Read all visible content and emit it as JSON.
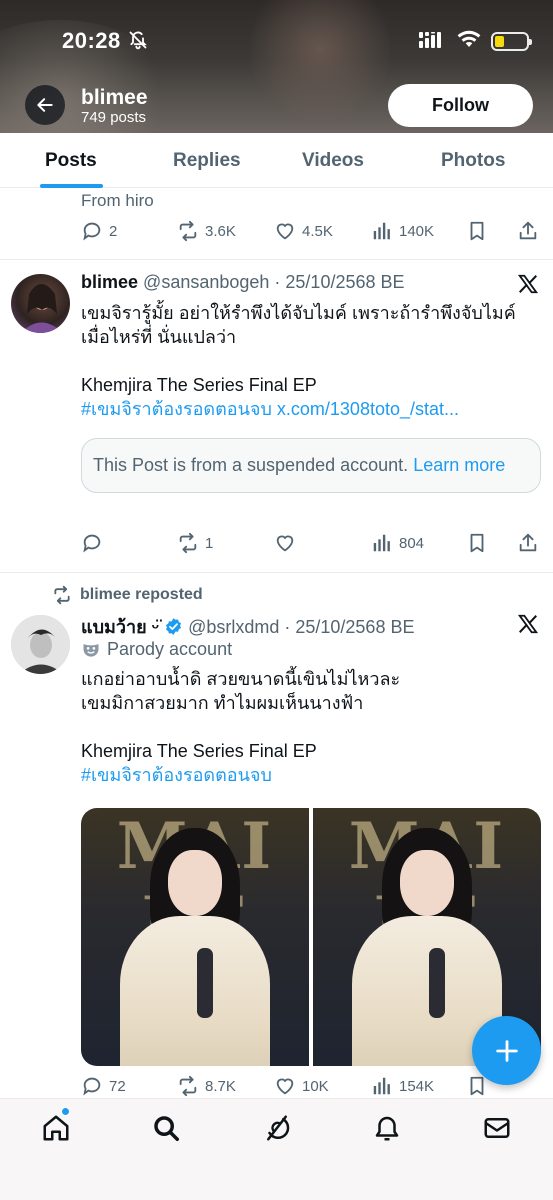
{
  "status_bar": {
    "time": "20:28"
  },
  "profile": {
    "name": "blimee",
    "posts_count": "749 posts",
    "follow_label": "Follow"
  },
  "tabs": [
    {
      "label": "Posts",
      "active": true
    },
    {
      "label": "Replies",
      "active": false
    },
    {
      "label": "Videos",
      "active": false
    },
    {
      "label": "Photos",
      "active": false
    }
  ],
  "feed": {
    "partial_post": {
      "text": "From hiro",
      "replies": "2",
      "reposts": "3.6K",
      "likes": "4.5K",
      "views": "140K"
    },
    "post1": {
      "name": "blimee",
      "meta": "@sansanbogeh · 25/10/2568 BE",
      "line1": "เขมจิรารู้มั้ย อย่าให้รำพึงได้จับไมค์ เพราะถ้ารำพึงจับไมค์",
      "line2": "เมื่อไหร่ที่ นั่นแปลว่า",
      "line3": "Khemjira The Series Final EP",
      "hashtag": "#เขมจิราต้องรอดตอนจบ",
      "link": "x.com/1308toto_/stat...",
      "quote_text": "This Post is from a suspended account.",
      "quote_link": "Learn more",
      "replies": "",
      "reposts": "1",
      "likes": "",
      "views": "804"
    },
    "post2": {
      "repost_label": "blimee reposted",
      "name": "แบมว้าย ᵕ̈",
      "meta": "@bsrlxdmd · 25/10/2568 BE",
      "parody_label": "Parody account",
      "line1": "แกอย่าอาบน้ำดิ สวยขนาดนี้เขินไม่ไหวละ",
      "line2": "เขมมิกาสวยมาก ทำไมผมเห็นนางฟ้า",
      "line3": "Khemjira The Series Final EP",
      "hashtag": "#เขมจิราต้องรอดตอนจบ",
      "image_text": "MAI\nBE",
      "replies": "72",
      "reposts": "8.7K",
      "likes": "10K",
      "views": "154K"
    }
  },
  "colors": {
    "accent": "#1d9bf0",
    "text": "#0f1419",
    "muted": "#536471",
    "battery_fill": "#f5d90a"
  },
  "icons": {
    "nav": [
      "home-icon",
      "search-icon",
      "grok-icon",
      "bell-icon",
      "mail-icon"
    ],
    "actions": [
      "reply-icon",
      "repost-icon",
      "like-icon",
      "views-icon",
      "bookmark-icon",
      "share-icon"
    ]
  }
}
